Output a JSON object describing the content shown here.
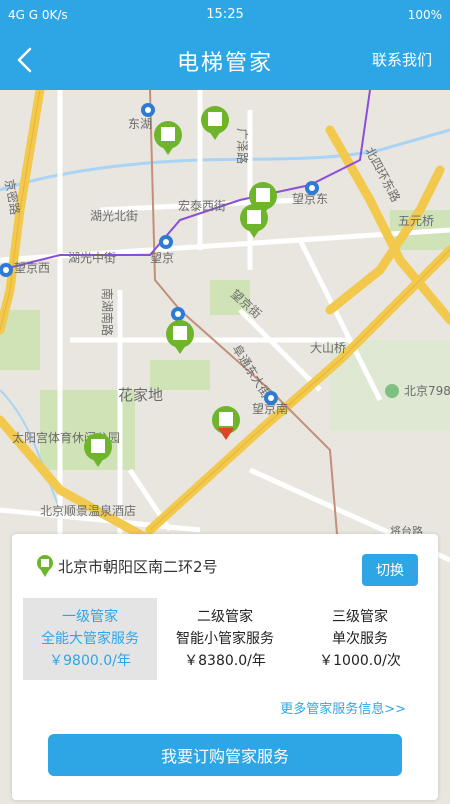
{
  "status_bar": {
    "left": "4G  G  0K/s",
    "time": "15:25",
    "right": "100%"
  },
  "header": {
    "back_icon": "back-arrow-icon",
    "title": "电梯管家",
    "contact": "联系我们"
  },
  "map": {
    "labels": {
      "dongh": "东湖",
      "guangze": "广泽路",
      "north4": "北四环东路",
      "wuyuan": "五元桥",
      "hongt": "宏泰西街",
      "huguang_n": "湖光北街",
      "wangjing_e": "望京东",
      "wangjing": "望京",
      "huguang_m": "湖光中街",
      "wangjing_w": "望京西",
      "jingmi": "京密路",
      "nanhu": "南湖南路",
      "wangjingjie": "望京街",
      "fushi": "阜通东大街",
      "daxiqiao": "大山桥",
      "huajiadi": "花家地",
      "beijing798": "北京798",
      "wangjing_s": "望京南",
      "taiyanggong": "太阳宫体育休闲公园",
      "shunjing": "北京顺景温泉酒店",
      "jiangtai": "将台路"
    }
  },
  "card": {
    "address": "北京市朝阳区南二环2号",
    "switch_label": "切换",
    "tiers": [
      {
        "level": "一级管家",
        "name": "全能大管家服务",
        "price": "￥9800.0/年"
      },
      {
        "level": "二级管家",
        "name": "智能小管家服务",
        "price": "￥8380.0/年"
      },
      {
        "level": "三级管家",
        "name": "单次服务",
        "price": "￥1000.0/次"
      }
    ],
    "more_link": "更多管家服务信息>>",
    "order_button": "我要订购管家服务"
  },
  "colors": {
    "accent": "#2ea6e6",
    "marker": "#6fb52c",
    "highlight_bg": "#e4e4e4",
    "metro_purple": "#8a4fd6"
  }
}
